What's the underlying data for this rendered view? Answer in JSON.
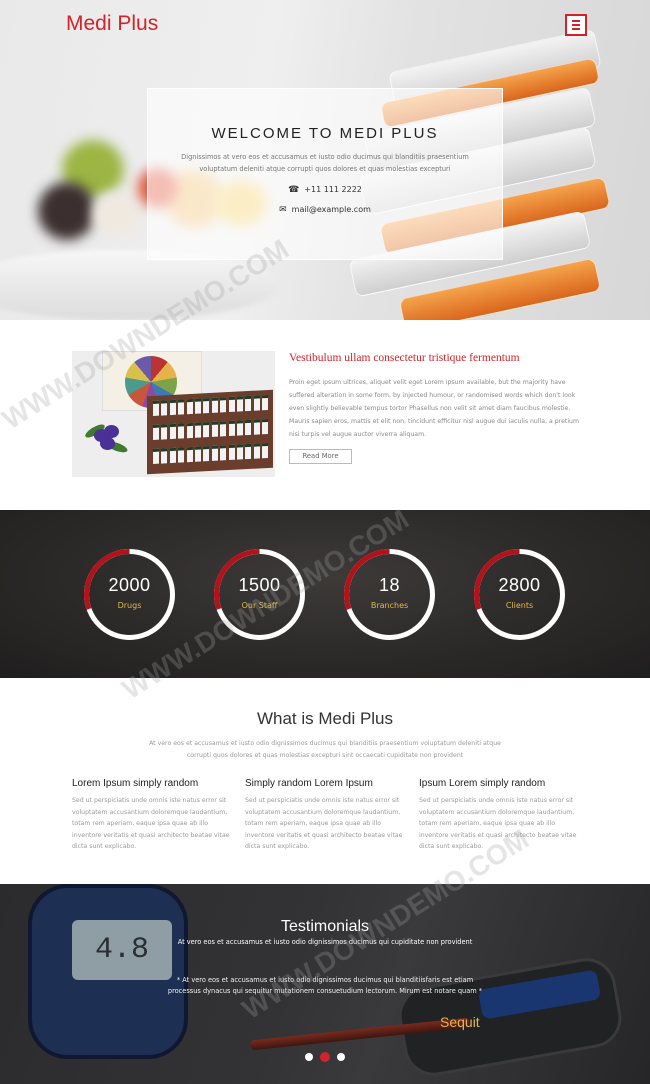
{
  "header": {
    "brand": "Medi Plus",
    "menu_icon": "hamburger-icon"
  },
  "hero": {
    "title": "WELCOME TO MEDI PLUS",
    "text": "Dignissimos at vero eos et accusamus et iusto odio ducimus qui blanditiis praesentium voluptatum deleniti atque corrupti quos dolores et quas molestias excepturi",
    "phone": "+11 111 2222",
    "email": "mail@example.com"
  },
  "about": {
    "title": "Vestibulum ullam consectetur tristique fermentum",
    "text": "Proin eget ipsum ultrices, aliquet velit eget Lorem ipsum available, but the majority have suffered alteration in some form, by injected humour, or randomised words which don't look even slightly believable tempus tortor Phasellus non velit sit amet diam faucibus molestie. Mauris sapien eros, mattis et elit non, tincidunt efficitur nisl augue dui iaculis nulla, a pretium nisi turpis vel augue auctor viverra aliquam.",
    "button": "Read More"
  },
  "stats": [
    {
      "value": "2000",
      "label": "Drugs"
    },
    {
      "value": "1500",
      "label": "Our Staff"
    },
    {
      "value": "18",
      "label": "Branches"
    },
    {
      "value": "2800",
      "label": "Clients"
    }
  ],
  "what": {
    "title": "What is Medi Plus",
    "subtitle": "At vero eos et accusamus et iusto odio dignissimos ducimus qui blanditiis praesentium voluptatum deleniti atque corrupti quos dolores et quas molestias excepturi sint occaecati cupiditate non provident",
    "columns": [
      {
        "title": "Lorem Ipsum simply random",
        "text": "Sed ut perspiciatis unde omnis iste natus error sit voluptatem accusantium doloremque laudantium, totam rem aperiam, eaque ipsa quae ab illo inventore veritatis et quasi architecto beatae vitae dicta sunt explicabo."
      },
      {
        "title": "Simply random Lorem Ipsum",
        "text": "Sed ut perspiciatis unde omnis iste natus error sit voluptatem accusantium doloremque laudantium, totam rem aperiam, eaque ipsa quae ab illo inventore veritatis et quasi architecto beatae vitae dicta sunt explicabo."
      },
      {
        "title": "Ipsum Lorem simply random",
        "text": "Sed ut perspiciatis unde omnis iste natus error sit voluptatem accusantium doloremque laudantium, totam rem aperiam, eaque ipsa quae ab illo inventore veritatis et quasi architecto beatae vitae dicta sunt explicabo."
      }
    ]
  },
  "testimonials": {
    "title": "Testimonials",
    "subtitle": "At vero eos et accusamus et iusto odio dignissimos ducimus qui cupiditate non provident",
    "quote": "* At vero eos et accusamus et iusto odio dignissimos ducimus qui blanditiisfaris est etiam processus dynacus qui sequitur mutationem consuetudium lectorum. Mirum est notare quam *",
    "author": "Sequit",
    "meter_reading": "4.8",
    "active_slide": 2,
    "slide_count": 3
  },
  "watermark": "WWW.DOWNDEMO.COM",
  "colors": {
    "accent": "#d2232a",
    "gold": "#e0b94a",
    "dark": "#2c2a29"
  }
}
